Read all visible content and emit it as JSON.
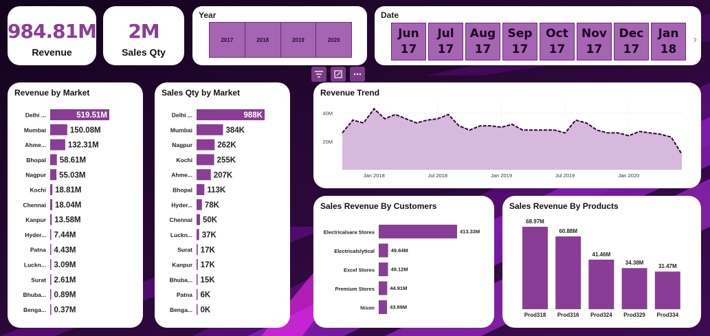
{
  "kpis": {
    "revenue": {
      "value": "984.81M",
      "label": "Revenue"
    },
    "sales_qty": {
      "value": "2M",
      "label": "Sales Qty"
    }
  },
  "year_slicer": {
    "title": "Year",
    "options": [
      "2017",
      "2018",
      "2019",
      "2020"
    ]
  },
  "date_slicer": {
    "title": "Date",
    "options": [
      {
        "month": "Jun",
        "year": "17"
      },
      {
        "month": "Jul",
        "year": "17"
      },
      {
        "month": "Aug",
        "year": "17"
      },
      {
        "month": "Sep",
        "year": "17"
      },
      {
        "month": "Oct",
        "year": "17"
      },
      {
        "month": "Nov",
        "year": "17"
      },
      {
        "month": "Dec",
        "year": "17"
      },
      {
        "month": "Jan",
        "year": "18"
      }
    ],
    "next_arrow": "›"
  },
  "toolbar": {
    "icons": [
      "filter-icon",
      "focus-mode-icon",
      "more-options-icon"
    ]
  },
  "colors": {
    "bar": "#8a3d96",
    "area": "#d6b9dc",
    "line": "#2a0a30",
    "kpi": "#8a3d96"
  },
  "chart_data": [
    {
      "id": "revenue_by_market",
      "type": "bar",
      "orientation": "horizontal",
      "title": "Revenue by Market",
      "categories": [
        "Delhi ...",
        "Mumbai",
        "Ahme...",
        "Bhopal",
        "Nagpur",
        "Kochi",
        "Chennai",
        "Kanpur",
        "Hyder...",
        "Patna",
        "Luckn...",
        "Surat",
        "Bhuba...",
        "Benga..."
      ],
      "values": [
        519.51,
        150.08,
        132.31,
        58.61,
        55.03,
        18.81,
        18.04,
        13.58,
        7.44,
        4.43,
        3.09,
        2.61,
        0.89,
        0.37
      ],
      "labels": [
        "519.51M",
        "150.08M",
        "132.31M",
        "58.61M",
        "55.03M",
        "18.81M",
        "18.04M",
        "13.58M",
        "7.44M",
        "4.43M",
        "3.09M",
        "2.61M",
        "0.89M",
        "0.37M"
      ]
    },
    {
      "id": "sales_qty_by_market",
      "type": "bar",
      "orientation": "horizontal",
      "title": "Sales Qty by Market",
      "categories": [
        "Delhi ...",
        "Mumbai",
        "Nagpur",
        "Kochi",
        "Ahme...",
        "Bhopal",
        "Hyder...",
        "Chennai",
        "Luckn...",
        "Surat",
        "Kanpur",
        "Bhuba...",
        "Patna",
        "Benga..."
      ],
      "values": [
        988,
        384,
        262,
        255,
        207,
        113,
        78,
        50,
        37,
        17,
        17,
        15,
        6,
        0
      ],
      "labels": [
        "988K",
        "384K",
        "262K",
        "255K",
        "207K",
        "113K",
        "78K",
        "50K",
        "37K",
        "17K",
        "17K",
        "15K",
        "6K",
        "0K"
      ]
    },
    {
      "id": "revenue_trend",
      "type": "area",
      "title": "Revenue Trend",
      "x_ticks": [
        "Jan 2018",
        "Jul 2018",
        "Jan 2019",
        "Jul 2019",
        "Jan 2020"
      ],
      "y_ticks": [
        "20M",
        "40M"
      ],
      "ylim": [
        0,
        48
      ],
      "grid": true,
      "x": [
        "Oct 2017",
        "Nov 2017",
        "Dec 2017",
        "Jan 2018",
        "Feb 2018",
        "Mar 2018",
        "Apr 2018",
        "May 2018",
        "Jun 2018",
        "Jul 2018",
        "Aug 2018",
        "Sep 2018",
        "Oct 2018",
        "Nov 2018",
        "Dec 2018",
        "Jan 2019",
        "Feb 2019",
        "Mar 2019",
        "Apr 2019",
        "May 2019",
        "Jun 2019",
        "Jul 2019",
        "Aug 2019",
        "Sep 2019",
        "Oct 2019",
        "Nov 2019",
        "Dec 2019",
        "Jan 2020",
        "Feb 2020",
        "Mar 2020",
        "Apr 2020",
        "May 2020",
        "Jun 2020"
      ],
      "values": [
        26,
        35,
        33,
        43,
        36,
        39,
        36,
        33,
        35,
        36,
        39,
        31,
        28,
        31,
        31,
        30,
        32,
        28,
        28,
        28,
        28,
        26,
        35,
        33,
        28,
        26,
        26,
        24,
        27,
        26,
        25,
        23,
        11
      ]
    },
    {
      "id": "sales_revenue_by_customers",
      "type": "bar",
      "orientation": "horizontal",
      "title": "Sales Revenue By Customers",
      "categories": [
        "Electricalsara Stores",
        "Electricalslytical",
        "Excel Stores",
        "Premium Stores",
        "Nixon"
      ],
      "values": [
        413.33,
        49.64,
        49.12,
        44.91,
        43.89
      ],
      "labels": [
        "413.33M",
        "49.64M",
        "49.12M",
        "44.91M",
        "43.89M"
      ]
    },
    {
      "id": "sales_revenue_by_products",
      "type": "bar",
      "orientation": "vertical",
      "title": "Sales Revenue By Products",
      "categories": [
        "Prod318",
        "Prod316",
        "Prod324",
        "Prod329",
        "Prod334"
      ],
      "values": [
        68.97,
        60.88,
        41.46,
        34.38,
        31.47
      ],
      "labels": [
        "68.97M",
        "60.88M",
        "41.46M",
        "34.38M",
        "31.47M"
      ]
    }
  ]
}
